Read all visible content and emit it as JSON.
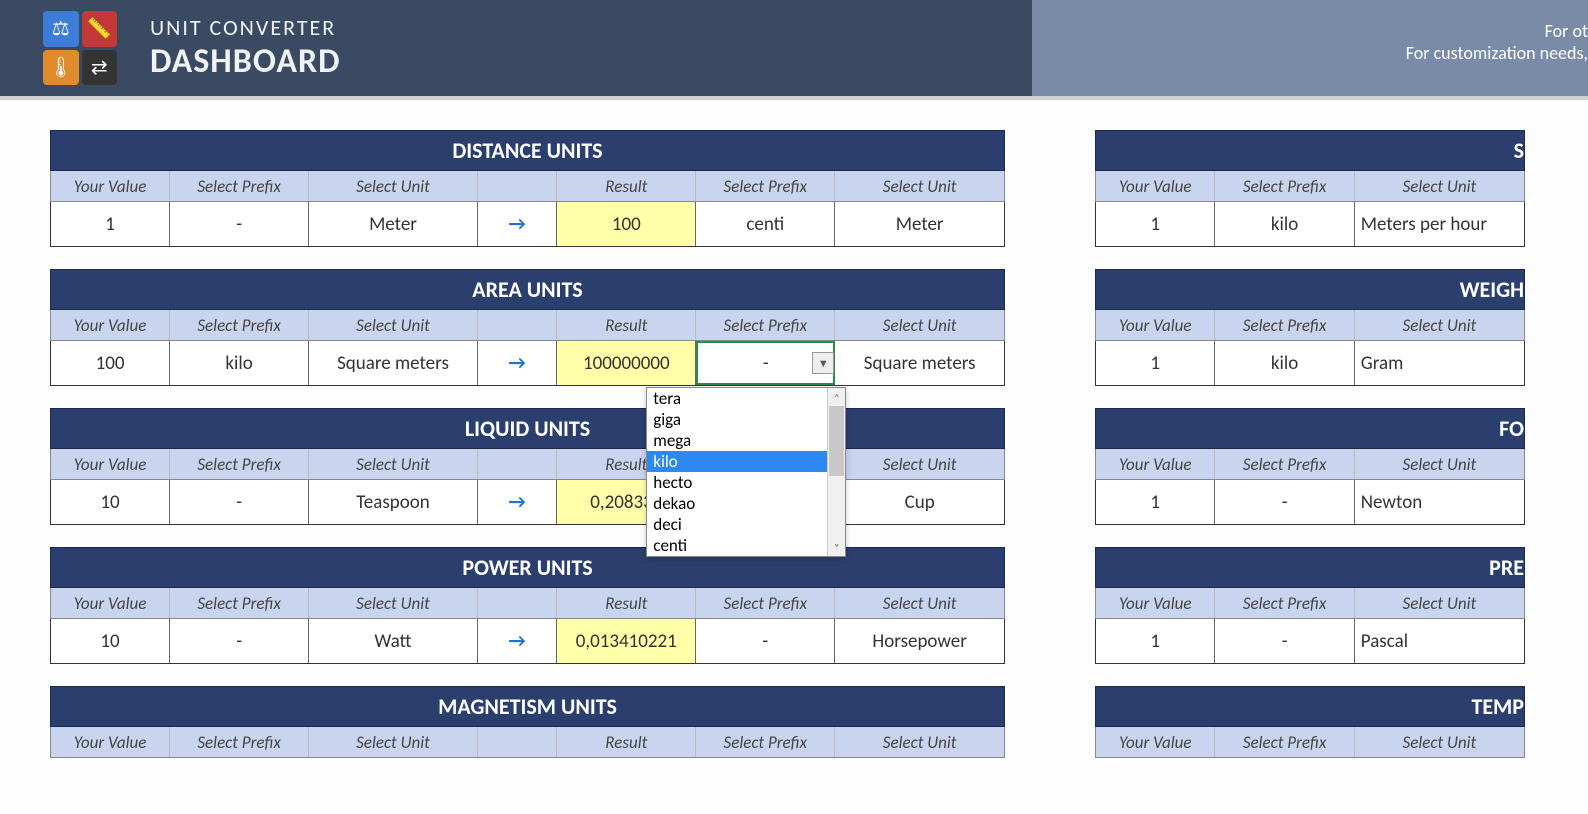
{
  "header": {
    "subtitle": "UNIT CONVERTER",
    "title": "DASHBOARD",
    "right_line1": "For ot",
    "right_line2": "For customization needs,"
  },
  "columns": {
    "your_value": "Your Value",
    "select_prefix": "Select Prefix",
    "select_unit": "Select Unit",
    "result": "Result"
  },
  "arrow": "→",
  "panels_left": [
    {
      "title": "DISTANCE UNITS",
      "value": "1",
      "prefix1": "-",
      "unit1": "Meter",
      "result": "100",
      "prefix2": "centi",
      "unit2": "Meter"
    },
    {
      "title": "AREA UNITS",
      "value": "100",
      "prefix1": "kilo",
      "unit1": "Square meters",
      "result": "100000000",
      "prefix2": "-",
      "unit2": "Square meters",
      "active_prefix2": true,
      "show_dd_btn": true
    },
    {
      "title": "LIQUID UNITS",
      "value": "10",
      "prefix1": "-",
      "unit1": "Teaspoon",
      "result": "0,208333",
      "prefix2": "",
      "unit2": "Cup"
    },
    {
      "title": "POWER UNITS",
      "value": "10",
      "prefix1": "-",
      "unit1": "Watt",
      "result": "0,013410221",
      "prefix2": "-",
      "unit2": "Horsepower"
    },
    {
      "title": "MAGNETISM UNITS",
      "value": "",
      "prefix1": "",
      "unit1": "",
      "result": "",
      "prefix2": "",
      "unit2": "",
      "no_row": true
    }
  ],
  "panels_right": [
    {
      "title": "S",
      "value": "1",
      "prefix1": "kilo",
      "unit1": "Meters per hour"
    },
    {
      "title": "WEIGH",
      "value": "1",
      "prefix1": "kilo",
      "unit1": "Gram"
    },
    {
      "title": "FO",
      "value": "1",
      "prefix1": "-",
      "unit1": "Newton"
    },
    {
      "title": "PRE",
      "value": "1",
      "prefix1": "-",
      "unit1": "Pascal"
    },
    {
      "title": "TEMP",
      "value": "",
      "prefix1": "",
      "unit1": "",
      "no_row": true
    }
  ],
  "dropdown": {
    "options": [
      "tera",
      "giga",
      "mega",
      "kilo",
      "hecto",
      "dekao",
      "deci",
      "centi"
    ],
    "selected": "kilo"
  }
}
